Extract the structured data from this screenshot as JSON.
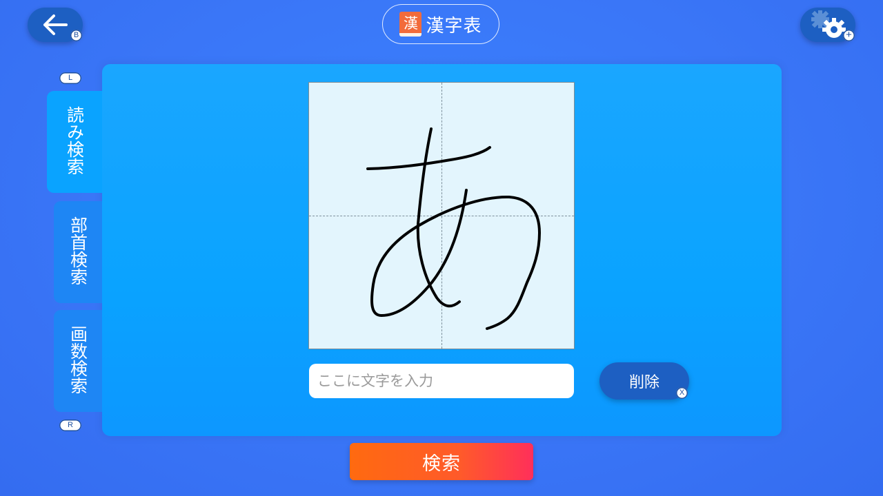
{
  "header": {
    "back_hint": "B",
    "title_icon_char": "漢",
    "title": "漢字表",
    "settings_hint": "+"
  },
  "tabs": {
    "shoulder_left": "L",
    "shoulder_right": "R",
    "items": [
      {
        "label": "読み検索",
        "active": true
      },
      {
        "label": "部首検索",
        "active": false
      },
      {
        "label": "画数検索",
        "active": false
      }
    ]
  },
  "canvas": {
    "drawn_character": "あ"
  },
  "input": {
    "value": "",
    "placeholder": "ここに文字を入力"
  },
  "delete_button": {
    "label": "削除",
    "hint": "X"
  },
  "search_button": {
    "label": "検索"
  },
  "colors": {
    "background": "#3a78f8",
    "panel": "#0aa3ff",
    "button_dark": "#1d5fc2",
    "search_gradient_start": "#ff6a10",
    "search_gradient_end": "#ff2f5a",
    "canvas_bg": "#e3f5fd"
  }
}
